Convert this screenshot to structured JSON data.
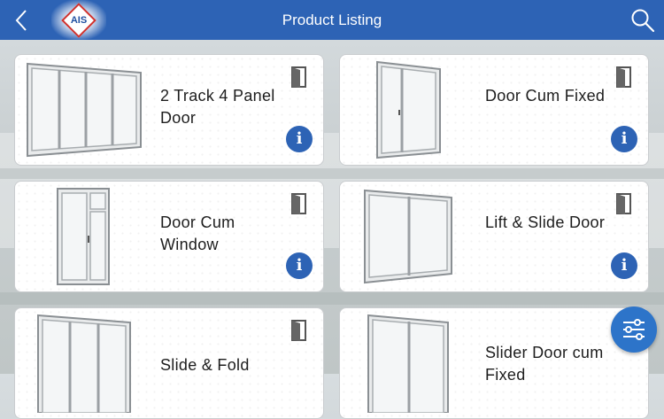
{
  "header": {
    "title": "Product Listing",
    "logo_text": "AIS",
    "back_icon": "chevron-left-icon",
    "search_icon": "search-icon",
    "color": "#2d63b5"
  },
  "products": [
    {
      "name": "2 Track 4 Panel Door"
    },
    {
      "name": "Door Cum Fixed"
    },
    {
      "name": "Door Cum Window"
    },
    {
      "name": "Lift & Slide Door"
    },
    {
      "name": "Slide & Fold"
    },
    {
      "name": "Slider Door cum Fixed"
    }
  ],
  "card_icons": {
    "top_right": "door-icon",
    "bottom_right": "info-icon",
    "info_glyph": "i"
  },
  "fab": {
    "icon": "filter-sliders-icon"
  }
}
